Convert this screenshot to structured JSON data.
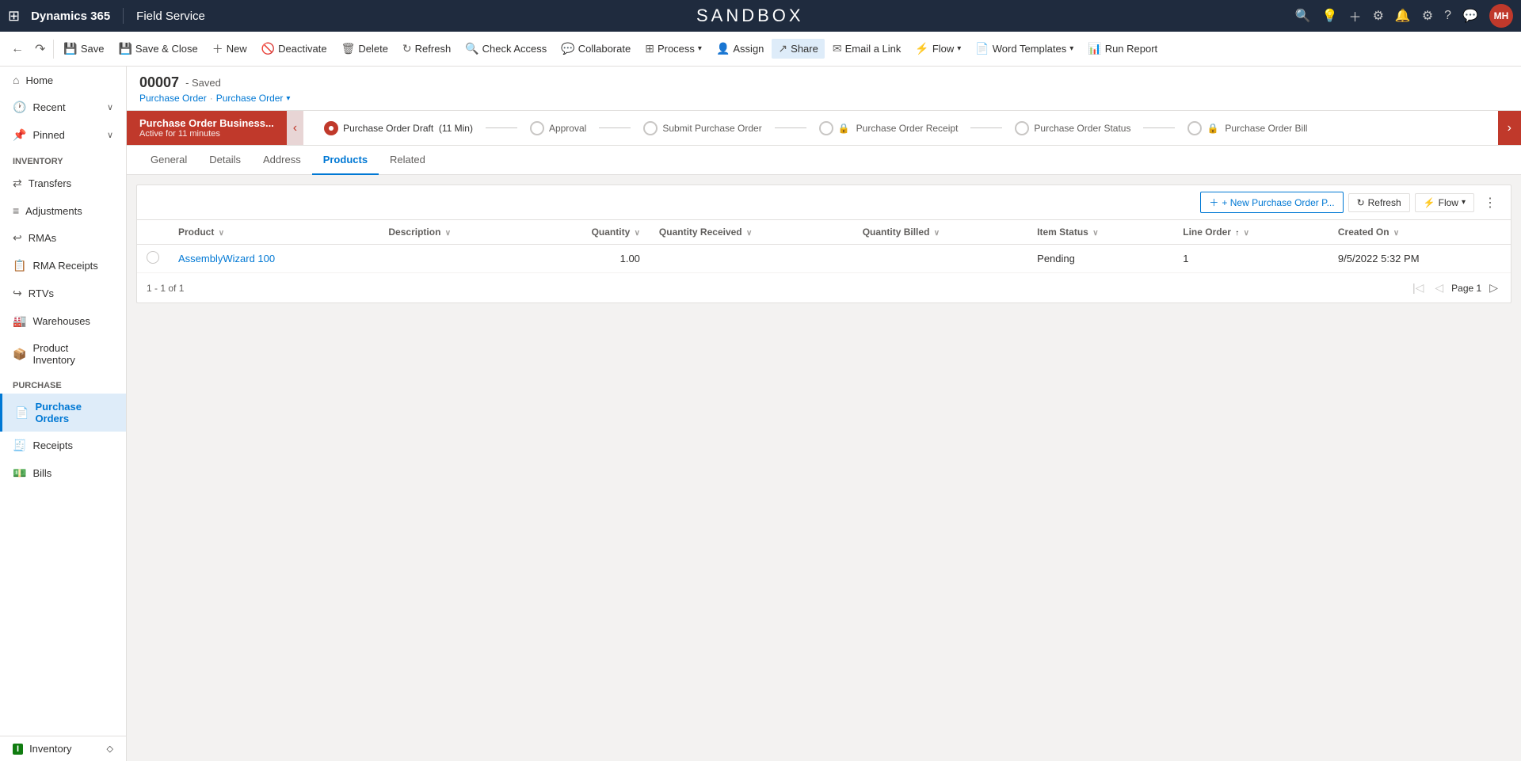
{
  "topnav": {
    "brand": "Dynamics 365",
    "divider": "|",
    "module": "Field Service",
    "sandbox": "SANDBOX",
    "avatar": "MH"
  },
  "toolbar": {
    "back_icon": "←",
    "forward_icon": "↻",
    "save": "Save",
    "save_close": "Save & Close",
    "new": "New",
    "deactivate": "Deactivate",
    "delete": "Delete",
    "refresh": "Refresh",
    "check_access": "Check Access",
    "collaborate": "Collaborate",
    "process": "Process",
    "assign": "Assign",
    "share": "Share",
    "email_link": "Email a Link",
    "flow": "Flow",
    "word_templates": "Word Templates",
    "run_report": "Run Report"
  },
  "sidebar": {
    "items_top": [
      {
        "id": "home",
        "label": "Home",
        "icon": "⌂"
      },
      {
        "id": "recent",
        "label": "Recent",
        "icon": "🕐",
        "arrow": "∨"
      },
      {
        "id": "pinned",
        "label": "Pinned",
        "icon": "📌",
        "arrow": "∨"
      }
    ],
    "sections": [
      {
        "title": "Inventory",
        "items": [
          {
            "id": "transfers",
            "label": "Transfers",
            "icon": "⇄"
          },
          {
            "id": "adjustments",
            "label": "Adjustments",
            "icon": "≡"
          },
          {
            "id": "rmas",
            "label": "RMAs",
            "icon": "↩"
          },
          {
            "id": "rma-receipts",
            "label": "RMA Receipts",
            "icon": "📋"
          },
          {
            "id": "rtvs",
            "label": "RTVs",
            "icon": "↪"
          },
          {
            "id": "warehouses",
            "label": "Warehouses",
            "icon": "🏭"
          },
          {
            "id": "product-inventory",
            "label": "Product Inventory",
            "icon": "📦"
          }
        ]
      },
      {
        "title": "Purchase",
        "items": [
          {
            "id": "purchase-orders",
            "label": "Purchase Orders",
            "icon": "📄",
            "active": true
          },
          {
            "id": "receipts",
            "label": "Receipts",
            "icon": "🧾"
          },
          {
            "id": "bills",
            "label": "Bills",
            "icon": "💵"
          }
        ]
      }
    ],
    "bottom": {
      "label": "Inventory",
      "icon": "ℹ"
    }
  },
  "record": {
    "number": "00007",
    "status": "Saved",
    "breadcrumb1": "Purchase Order",
    "breadcrumb2": "Purchase Order",
    "breadcrumb_sep": "·"
  },
  "stages": {
    "active": {
      "name": "Purchase Order Business...",
      "sub": "Active for 11 minutes"
    },
    "steps": [
      {
        "id": "draft",
        "label": "Purchase Order Draft  (11 Min)",
        "current": true,
        "lock": false
      },
      {
        "id": "approval",
        "label": "Approval",
        "current": false,
        "lock": false
      },
      {
        "id": "submit",
        "label": "Submit Purchase Order",
        "current": false,
        "lock": false
      },
      {
        "id": "receipt",
        "label": "Purchase Order Receipt",
        "current": false,
        "lock": true
      },
      {
        "id": "status",
        "label": "Purchase Order Status",
        "current": false,
        "lock": false
      },
      {
        "id": "bill",
        "label": "Purchase Order Bill",
        "current": false,
        "lock": true
      }
    ]
  },
  "tabs": [
    {
      "id": "general",
      "label": "General"
    },
    {
      "id": "details",
      "label": "Details"
    },
    {
      "id": "address",
      "label": "Address"
    },
    {
      "id": "products",
      "label": "Products",
      "active": true
    },
    {
      "id": "related",
      "label": "Related"
    }
  ],
  "subgrid": {
    "new_btn": "+ New Purchase Order P...",
    "refresh_btn": "Refresh",
    "flow_btn": "Flow",
    "columns": [
      {
        "id": "product",
        "label": "Product"
      },
      {
        "id": "description",
        "label": "Description"
      },
      {
        "id": "quantity",
        "label": "Quantity"
      },
      {
        "id": "qty_received",
        "label": "Quantity Received"
      },
      {
        "id": "qty_billed",
        "label": "Quantity Billed"
      },
      {
        "id": "item_status",
        "label": "Item Status"
      },
      {
        "id": "line_order",
        "label": "Line Order"
      },
      {
        "id": "created_on",
        "label": "Created On"
      }
    ],
    "rows": [
      {
        "product": "AssemblyWizard 100",
        "description": "",
        "quantity": "1.00",
        "qty_received": "",
        "qty_billed": "",
        "item_status": "Pending",
        "line_order": "1",
        "created_on": "9/5/2022 5:32 PM"
      }
    ],
    "pagination": {
      "count": "1 - 1 of 1",
      "page_label": "Page 1"
    }
  }
}
